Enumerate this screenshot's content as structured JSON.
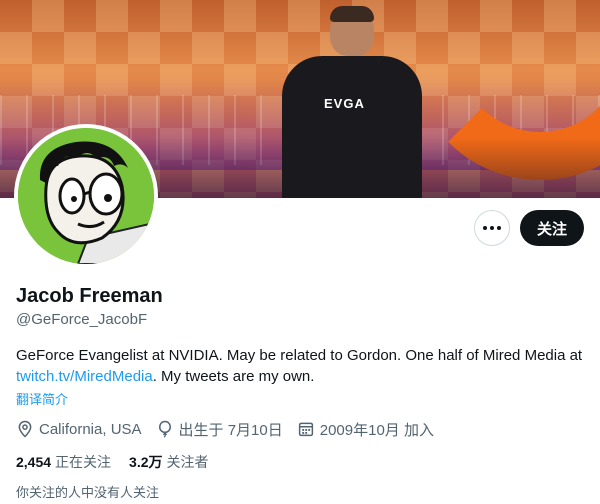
{
  "profile": {
    "display_name": "Jacob Freeman",
    "handle": "@GeForce_JacobF",
    "bio_text": "GeForce Evangelist at NVIDIA. May be related to Gordon. One half of Mired Media at ",
    "bio_link": "twitch.tv/MiredMedia",
    "bio_suffix": ". My tweets are my own.",
    "translate_label": "翻译简介",
    "location": "California, USA",
    "birthday": "出生于 7月10日",
    "joined": "2009年10月 加入",
    "following_count": "2,454",
    "following_label": "正在关注",
    "followers_count": "3.2万",
    "followers_label": "关注者",
    "known_followers": "你关注的人中没有人关注"
  },
  "actions": {
    "follow_label": "关注",
    "more_icon": "more-icon"
  },
  "banner": {
    "shirt_logo": "EVGA"
  },
  "colors": {
    "link": "#1d9bf0",
    "secondary_text": "#536471",
    "primary_text": "#0f1419",
    "avatar_bg": "#79c43a"
  },
  "icons": [
    "location-icon",
    "balloon-icon",
    "calendar-icon",
    "more-icon"
  ]
}
